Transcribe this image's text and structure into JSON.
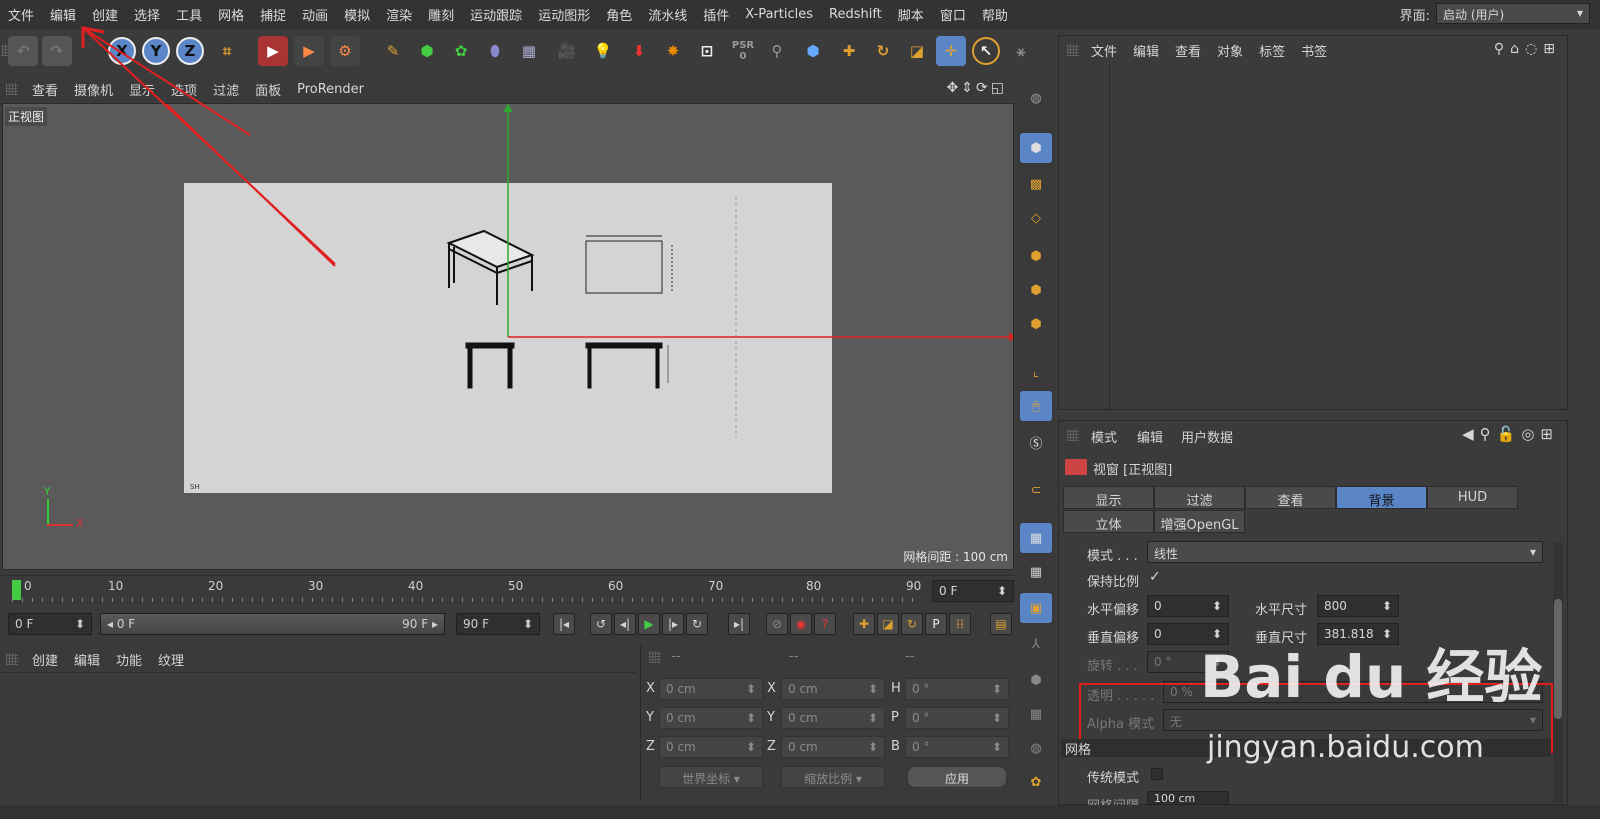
{
  "menubar": {
    "items": [
      "文件",
      "编辑",
      "创建",
      "选择",
      "工具",
      "网格",
      "捕捉",
      "动画",
      "模拟",
      "渲染",
      "雕刻",
      "运动跟踪",
      "运动图形",
      "角色",
      "流水线",
      "插件",
      "X-Particles",
      "Redshift",
      "脚本",
      "窗口",
      "帮助"
    ],
    "layout_label": "界面:",
    "layout_value": "启动 (用户)"
  },
  "toolbar": {
    "axis_x": "X",
    "axis_y": "Y",
    "axis_z": "Z",
    "psr": "PSR",
    "psr_value": "0"
  },
  "viewport": {
    "menu": [
      "查看",
      "摄像机",
      "显示",
      "选项",
      "过滤",
      "面板",
      "ProRender"
    ],
    "view_name": "正视图",
    "grid_readout": "网格间距 : 100 cm",
    "axis_y": "Y",
    "axis_x": "X",
    "drawing_note": "SH"
  },
  "timeline": {
    "ticks": [
      "0",
      "10",
      "20",
      "30",
      "40",
      "50",
      "60",
      "70",
      "80",
      "90"
    ],
    "current_frame": "0 F"
  },
  "transport": {
    "start_frame": "0 F",
    "range_start": "0 F",
    "range_end": "90 F",
    "end_frame": "90 F"
  },
  "material_manager": {
    "menu": [
      "创建",
      "编辑",
      "功能",
      "纹理"
    ]
  },
  "coordinates": {
    "header": [
      "--",
      "--",
      "--"
    ],
    "rows": [
      {
        "l1": "X",
        "v1": "0 cm",
        "l2": "X",
        "v2": "0 cm",
        "l3": "H",
        "v3": "0 °"
      },
      {
        "l1": "Y",
        "v1": "0 cm",
        "l2": "Y",
        "v2": "0 cm",
        "l3": "P",
        "v3": "0 °"
      },
      {
        "l1": "Z",
        "v1": "0 cm",
        "l2": "Z",
        "v2": "0 cm",
        "l3": "B",
        "v3": "0 °"
      }
    ],
    "world_coords": "世界坐标",
    "scale": "缩放比例",
    "apply": "应用"
  },
  "object_manager": {
    "menu": [
      "文件",
      "编辑",
      "查看",
      "对象",
      "标签",
      "书签"
    ]
  },
  "attributes": {
    "menu": [
      "模式",
      "编辑",
      "用户数据"
    ],
    "title": "视窗 [正视图]",
    "tabs_row1": [
      "显示",
      "过滤",
      "查看",
      "背景",
      "HUD"
    ],
    "tabs_row2": [
      "立体",
      "增强OpenGL"
    ],
    "active_tab": "背景",
    "mode_label": "模式 . . .",
    "mode_value": "线性",
    "keep_ratio": "保持比例",
    "keep_ratio_check": "✓",
    "h_offset_label": "水平偏移",
    "h_offset": "0",
    "h_size_label": "水平尺寸",
    "h_size": "800",
    "v_offset_label": "垂直偏移",
    "v_offset": "0",
    "v_size_label": "垂直尺寸",
    "v_size": "381.818",
    "rotation_label": "旋转 . . .",
    "rotation": "0 °",
    "transparency_label": "透明 . . . . .",
    "transparency": "0 %",
    "alpha_label": "Alpha 模式",
    "alpha_value": "无",
    "grid_section": "网格",
    "legacy_label": "传统模式",
    "grid_spacing_label": "网格间隔",
    "grid_spacing": "100 cm"
  },
  "watermark": {
    "logo": "Bai du 经验",
    "url": "jingyan.baidu.com"
  },
  "colors": {
    "accent_blue": "#5a86c8",
    "annotation_red": "#e02020",
    "axis_green": "#2fa82f"
  }
}
